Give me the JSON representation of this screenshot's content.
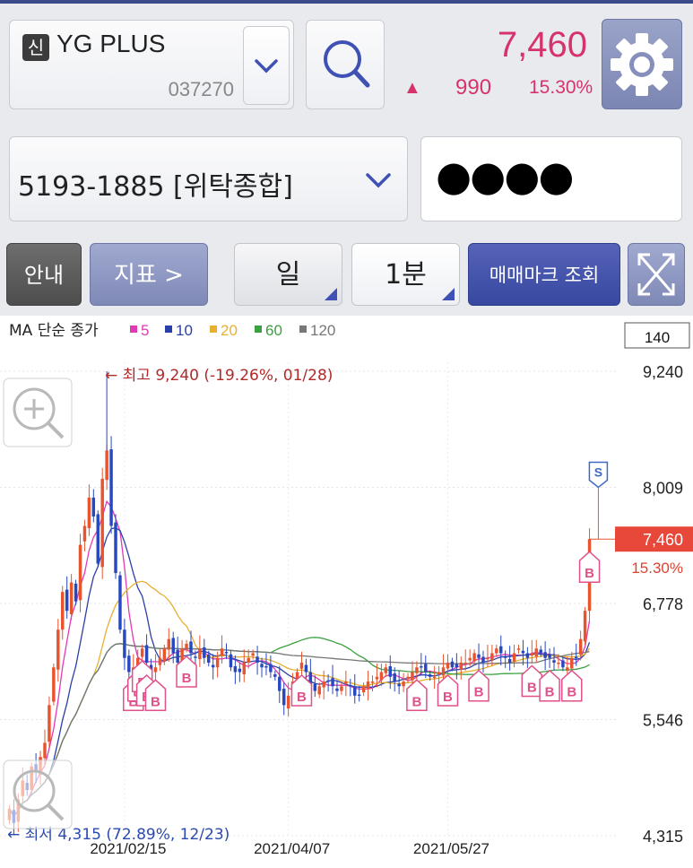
{
  "header": {
    "badge": "신",
    "stock_name": "YG PLUS",
    "stock_code": "037270",
    "price": "7,460",
    "change_arrow": "▲",
    "change": "990",
    "change_rate": "15.30%",
    "accent_up": "#d6336c"
  },
  "account": {
    "label": "5193-1885 [위탁종합]",
    "password_mask": "●●●●"
  },
  "toolbar": {
    "info_label": "안내",
    "indicator_label": "지표 >",
    "period_label": "일",
    "minute_label": "1분",
    "mark_label": "매매마크 조회"
  },
  "icons": [
    "stock-badge",
    "chevron-down-icon",
    "search-icon",
    "gear-icon",
    "expand-icon",
    "zoom-in-icon",
    "zoom-out-icon"
  ],
  "ma_legend": {
    "prefix": "MA 단순 종가",
    "items": [
      {
        "label": "5",
        "color": "#e03ab5"
      },
      {
        "label": "10",
        "color": "#2b3fa8"
      },
      {
        "label": "20",
        "color": "#e8b030"
      },
      {
        "label": "60",
        "color": "#3aa040"
      },
      {
        "label": "120",
        "color": "#777777"
      }
    ]
  },
  "chart_data": {
    "type": "candlestick",
    "count_box": "140",
    "y_ticks": [
      "9,240",
      "8,009",
      "6,778",
      "5,546",
      "4,315"
    ],
    "y_tick_values": [
      9240,
      8009,
      6778,
      5546,
      4315
    ],
    "ylim": [
      4315,
      9240
    ],
    "x_tick_labels": [
      "2021/02/15",
      "2021/04/07",
      "2021/05/27"
    ],
    "current_price_label": "7,460",
    "current_rate_label": "15.30%",
    "current_value": 7460,
    "high_annotation": "← 최고 9,240 (-19.26%, 01/28)",
    "low_annotation": "← 최저 4,315 (72.89%, 12/23)",
    "sell_marker": "S",
    "buy_marker": "B",
    "up_color": "#e8542e",
    "down_color": "#2848c0",
    "ma_colors": {
      "ma5": "#e03ab5",
      "ma10": "#2b3fa8",
      "ma20": "#e8b030",
      "ma60": "#3aa040",
      "ma120": "#777777"
    },
    "closes": [
      4600,
      4450,
      4700,
      4900,
      4800,
      5050,
      5000,
      5150,
      5300,
      5700,
      6100,
      6500,
      6900,
      6700,
      7000,
      6800,
      7400,
      7600,
      7900,
      7700,
      7200,
      8100,
      8400,
      7600,
      7100,
      6500,
      6200,
      6050,
      6100,
      6200,
      6300,
      6150,
      6050,
      6100,
      6200,
      6300,
      6400,
      6250,
      6150,
      6300,
      6350,
      6250,
      6200,
      6300,
      6200,
      6150,
      6100,
      6200,
      6300,
      6250,
      6100,
      6050,
      6050,
      6150,
      6200,
      6250,
      6150,
      6100,
      6100,
      6050,
      6000,
      5850,
      5700,
      5800,
      5950,
      6050,
      6150,
      6050,
      5900,
      5850,
      5900,
      5950,
      5950,
      5900,
      5850,
      5900,
      5950,
      5900,
      5800,
      5800,
      5900,
      5950,
      5950,
      6000,
      6050,
      6100,
      6000,
      5950,
      5900,
      5950,
      6000,
      6050,
      6100,
      6100,
      6050,
      6000,
      6000,
      6050,
      6100,
      6150,
      6100,
      6100,
      6150,
      6150,
      6200,
      6250,
      6200,
      6150,
      6200,
      6250,
      6300,
      6250,
      6200,
      6150,
      6250,
      6300,
      6250,
      6200,
      6250,
      6300,
      6250,
      6200,
      6200,
      6150,
      6150,
      6100,
      6100,
      6200,
      6200,
      6400,
      6700,
      7460
    ],
    "buy_signals": [
      28,
      29,
      30,
      31,
      33,
      40,
      66,
      92,
      99,
      106,
      118,
      122,
      127,
      131
    ],
    "sell_signals": [
      133
    ]
  }
}
